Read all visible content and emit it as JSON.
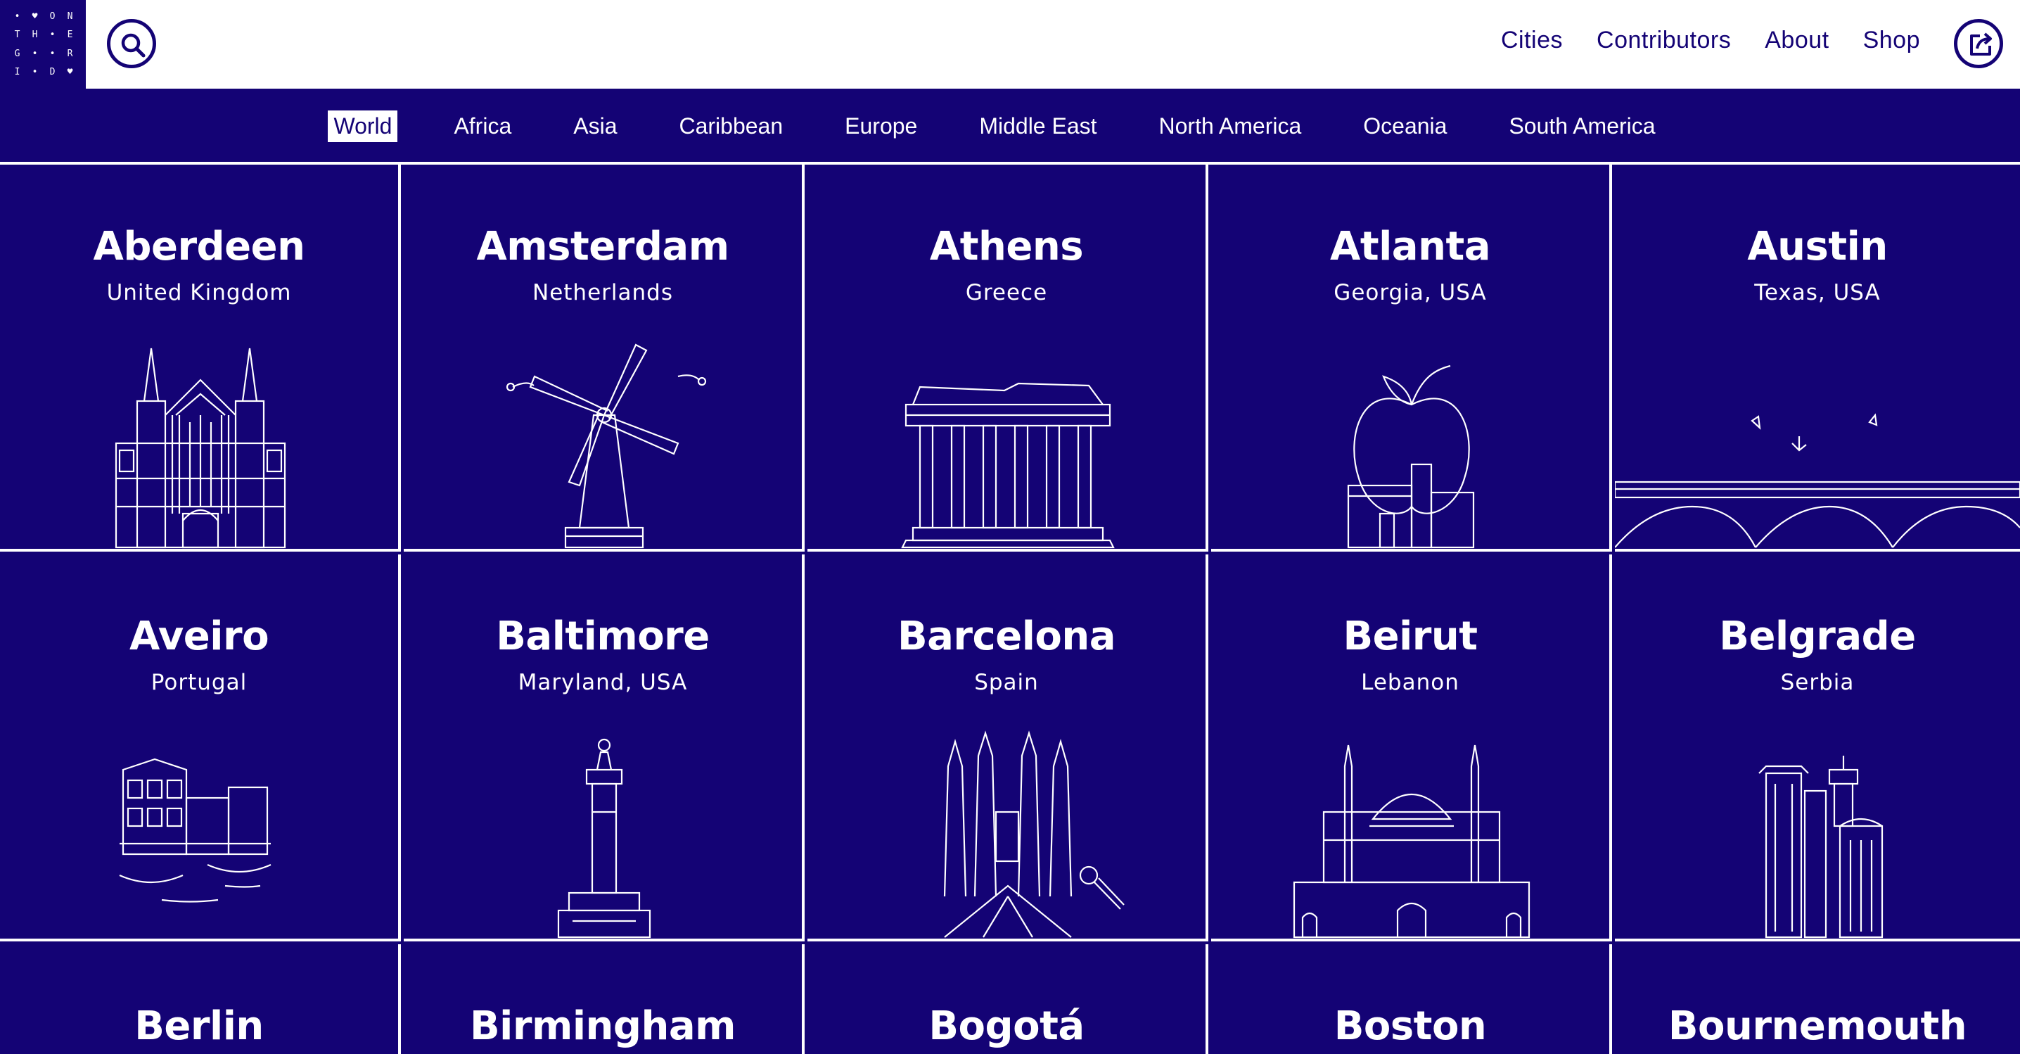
{
  "logo": {
    "letters": [
      "•",
      "♥",
      "O",
      "N",
      "T",
      "H",
      "•",
      "E",
      "G",
      "•",
      "•",
      "R",
      "I",
      "•",
      "D",
      "♥"
    ]
  },
  "top_nav": [
    {
      "label": "Cities"
    },
    {
      "label": "Contributors"
    },
    {
      "label": "About"
    },
    {
      "label": "Shop"
    }
  ],
  "regions": [
    {
      "label": "World",
      "active": true
    },
    {
      "label": "Africa"
    },
    {
      "label": "Asia"
    },
    {
      "label": "Caribbean"
    },
    {
      "label": "Europe"
    },
    {
      "label": "Middle East"
    },
    {
      "label": "North America"
    },
    {
      "label": "Oceania"
    },
    {
      "label": "South America"
    }
  ],
  "cities": [
    {
      "name": "Aberdeen",
      "country": "United Kingdom",
      "icon": "cathedral-icon"
    },
    {
      "name": "Amsterdam",
      "country": "Netherlands",
      "icon": "windmill-icon"
    },
    {
      "name": "Athens",
      "country": "Greece",
      "icon": "parthenon-icon"
    },
    {
      "name": "Atlanta",
      "country": "Georgia, USA",
      "icon": "peach-icon"
    },
    {
      "name": "Austin",
      "country": "Texas, USA",
      "icon": "bridge-bats-icon"
    },
    {
      "name": "Aveiro",
      "country": "Portugal",
      "icon": "houses-boats-icon"
    },
    {
      "name": "Baltimore",
      "country": "Maryland, USA",
      "icon": "monument-icon"
    },
    {
      "name": "Barcelona",
      "country": "Spain",
      "icon": "sagrada-familia-icon"
    },
    {
      "name": "Beirut",
      "country": "Lebanon",
      "icon": "mosque-icon"
    },
    {
      "name": "Belgrade",
      "country": "Serbia",
      "icon": "towers-icon"
    },
    {
      "name": "Berlin",
      "country": ""
    },
    {
      "name": "Birmingham",
      "country": ""
    },
    {
      "name": "Bogotá",
      "country": ""
    },
    {
      "name": "Boston",
      "country": ""
    },
    {
      "name": "Bournemouth",
      "country": ""
    }
  ],
  "colors": {
    "brand": "#140375",
    "background": "#ffffff",
    "line": "#ffffff"
  }
}
